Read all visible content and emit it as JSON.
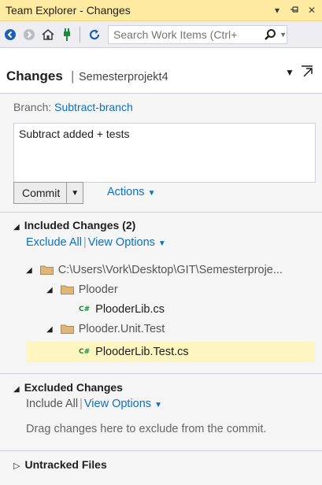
{
  "window": {
    "title": "Team Explorer - Changes",
    "controls": [
      "▾",
      "⊓",
      "✕"
    ]
  },
  "toolbar": {
    "search_placeholder": "Search Work Items (Ctrl+"
  },
  "header": {
    "title": "Changes",
    "separator": "|",
    "project": "Semesterprojekt4"
  },
  "branch": {
    "label": "Branch:",
    "name": "Subtract-branch"
  },
  "commit": {
    "message": "Subtract added + tests",
    "button_label": "Commit",
    "actions_label": "Actions"
  },
  "included": {
    "title": "Included Changes (2)",
    "exclude_all": "Exclude All",
    "view_options": "View Options",
    "tree": {
      "root": "C:\\Users\\Vork\\Desktop\\GIT\\Semesterproje...",
      "folder1": "Plooder",
      "file1": "PlooderLib.cs",
      "folder2": "Plooder.Unit.Test",
      "file2": "PlooderLib.Test.cs"
    }
  },
  "excluded": {
    "title": "Excluded Changes",
    "include_all": "Include All",
    "view_options": "View Options",
    "hint": "Drag changes here to exclude from the commit."
  },
  "untracked": {
    "title": "Untracked Files"
  },
  "colors": {
    "title_bar": "#ffeaa2",
    "link": "#0e70c0",
    "selection": "#fef5c0",
    "background": "#f5f5f5"
  }
}
